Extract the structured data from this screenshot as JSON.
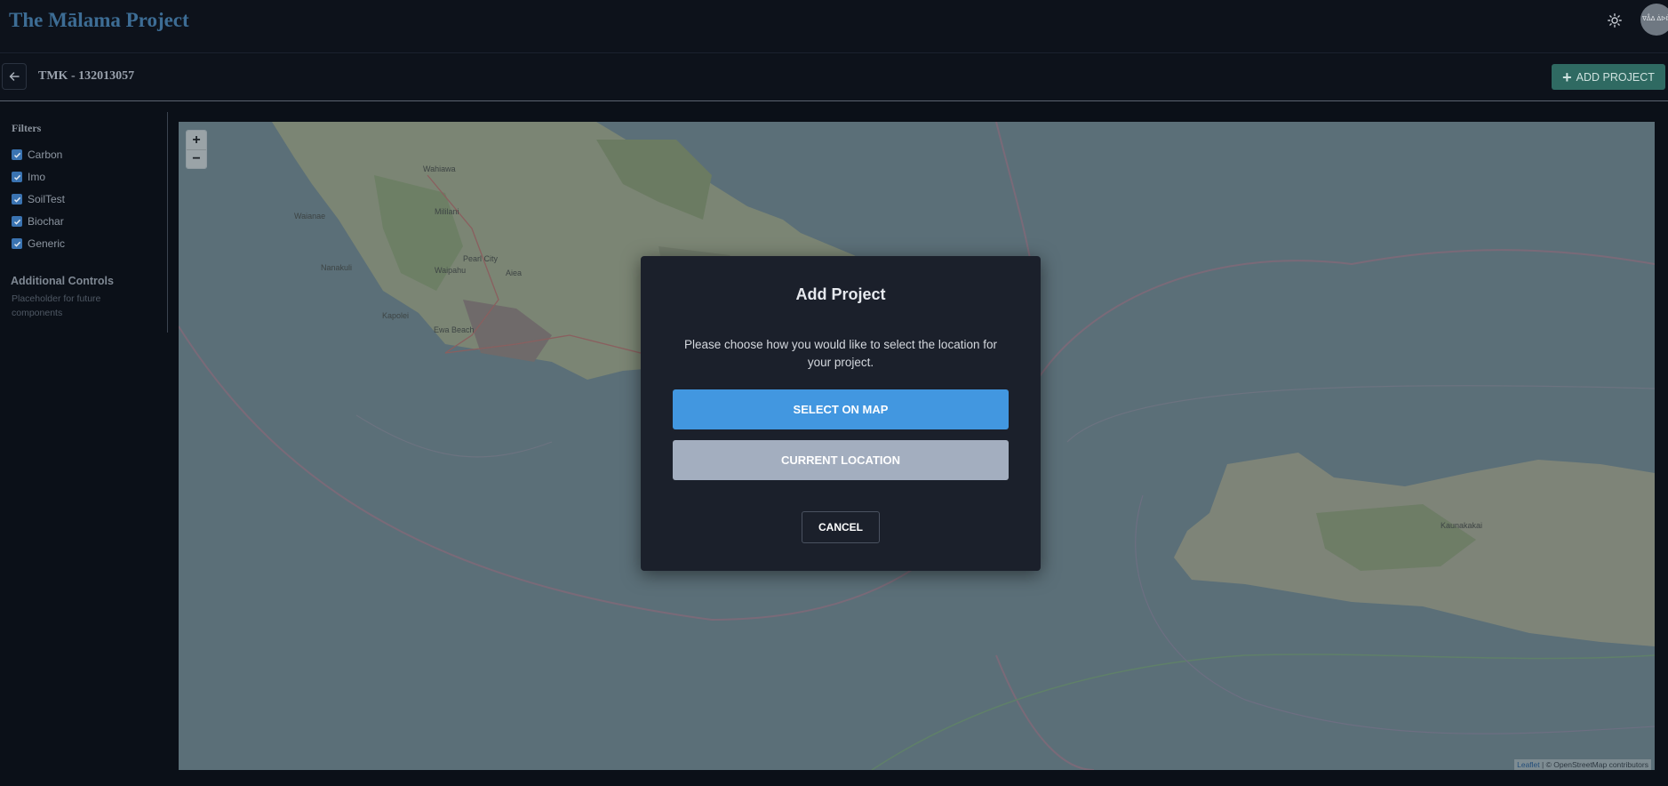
{
  "header": {
    "brand": "The Mālama Project",
    "avatar_text": "ᐁᐂᐃ ᐄᐅᐆ"
  },
  "subheader": {
    "title": "TMK - 132013057",
    "add_project_label": "ADD PROJECT"
  },
  "sidebar": {
    "filters_title": "Filters",
    "filters": [
      {
        "label": "Carbon",
        "checked": true
      },
      {
        "label": "Imo",
        "checked": true
      },
      {
        "label": "SoilTest",
        "checked": true
      },
      {
        "label": "Biochar",
        "checked": true
      },
      {
        "label": "Generic",
        "checked": true
      }
    ],
    "additional_title": "Additional Controls",
    "additional_desc": "Placeholder for future components"
  },
  "map": {
    "zoom_in": "+",
    "zoom_out": "−",
    "attribution_leaflet": "Leaflet",
    "attribution_rest": " | © OpenStreetMap contributors",
    "places": {
      "wahiawa": "Wahiawa",
      "mililani": "Mililani",
      "waianae": "Waianae",
      "nanakuli": "Nanakuli",
      "waipahu": "Waipahu",
      "pearl_city": "Pearl City",
      "aiea": "Aiea",
      "kapolei": "Kapolei",
      "ewa_beach": "Ewa Beach",
      "kaunakakai": "Kaunakakai"
    }
  },
  "modal": {
    "title": "Add Project",
    "description": "Please choose how you would like to select the location for your project.",
    "select_on_map": "SELECT ON MAP",
    "current_location": "CURRENT LOCATION",
    "cancel": "CANCEL"
  },
  "colors": {
    "primary_button": "#4297e0",
    "secondary_button": "#a3aebf",
    "add_project": "#2f6a62",
    "brand": "#3d6d95"
  }
}
